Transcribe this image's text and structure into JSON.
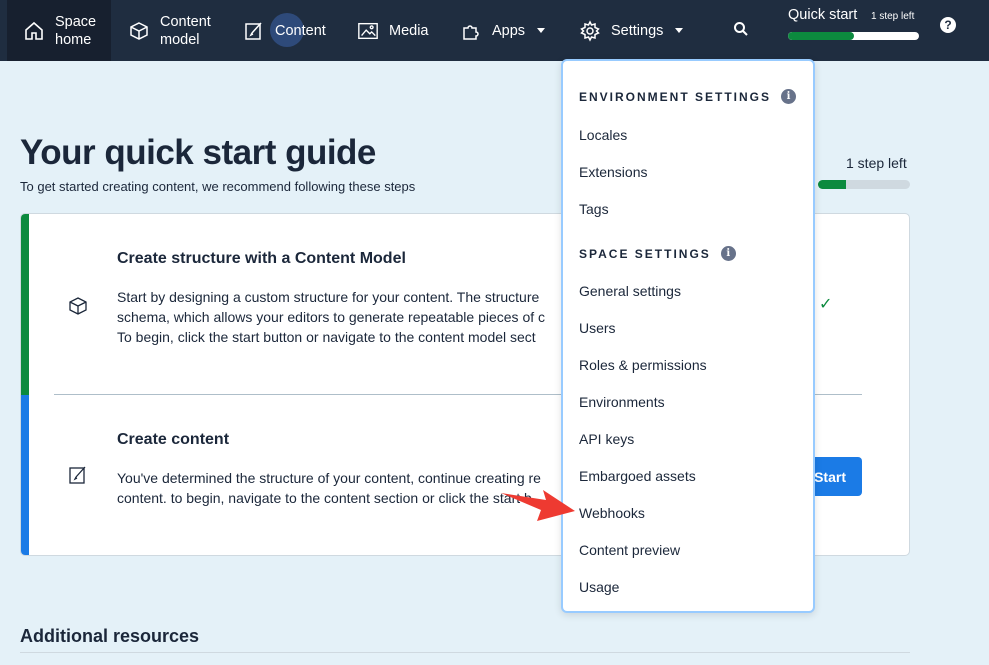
{
  "nav": {
    "space_home": "Space\nhome",
    "content_model": "Content\nmodel",
    "content": "Content",
    "media": "Media",
    "apps": "Apps",
    "settings": "Settings",
    "quick_start": {
      "title": "Quick start",
      "steps_left": "1 step left",
      "progress": 0.5
    },
    "help": "?"
  },
  "main": {
    "title": "Your quick start guide",
    "subtitle": "To get started creating content, we recommend following these steps",
    "steps_left": "1 step left",
    "progress": 0.3,
    "steps": [
      {
        "title": "Create structure with a Content Model",
        "line1": "Start by designing a custom structure for your content. The structure",
        "line2": "schema, which allows your editors to generate repeatable pieces of c",
        "line3": "To begin, click the start button or navigate to the content model sect",
        "done": true
      },
      {
        "title": "Create content",
        "line1": "You've determined the structure of your content, continue creating re",
        "line2": "content. to begin, navigate to the content section or click the start b",
        "button": "Start"
      }
    ],
    "additional_resources": "Additional resources"
  },
  "dropdown": {
    "environment_settings": "ENVIRONMENT SETTINGS",
    "env_items": [
      "Locales",
      "Extensions",
      "Tags"
    ],
    "space_settings": "SPACE SETTINGS",
    "space_items": [
      "General settings",
      "Users",
      "Roles & permissions",
      "Environments",
      "API keys",
      "Embargoed assets",
      "Webhooks",
      "Content preview",
      "Usage"
    ],
    "info_icon": "i"
  },
  "colors": {
    "nav_bg": "#1f2d40",
    "page_bg": "#e4f1f8",
    "green": "#0c8a3e",
    "blue": "#1b7be6",
    "arrow": "#ee3a31"
  }
}
